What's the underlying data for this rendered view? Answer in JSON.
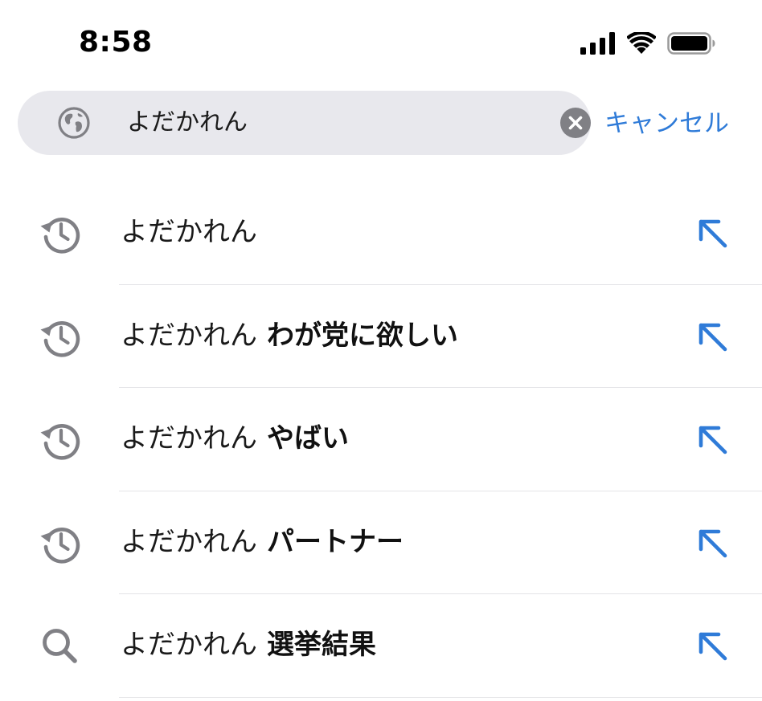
{
  "status_bar": {
    "time": "8:58",
    "icons": [
      "cellular-signal-icon",
      "wifi-icon",
      "battery-icon"
    ]
  },
  "search": {
    "query": "よだかれん",
    "globe_icon": "globe-icon",
    "clear_icon": "clear-icon",
    "cancel_label": "キャンセル"
  },
  "colors": {
    "accent": "#2f7bd8",
    "field_bg": "#e8e8ed",
    "icon_gray": "#808085",
    "divider": "#e4e4e7"
  },
  "suggestions": [
    {
      "icon": "history-icon",
      "base": "よだかれん",
      "suffix": ""
    },
    {
      "icon": "history-icon",
      "base": "よだかれん",
      "suffix": "わが党に欲しい"
    },
    {
      "icon": "history-icon",
      "base": "よだかれん",
      "suffix": "やばい"
    },
    {
      "icon": "history-icon",
      "base": "よだかれん",
      "suffix": "パートナー"
    },
    {
      "icon": "search-icon",
      "base": "よだかれん",
      "suffix": "選挙結果"
    }
  ]
}
